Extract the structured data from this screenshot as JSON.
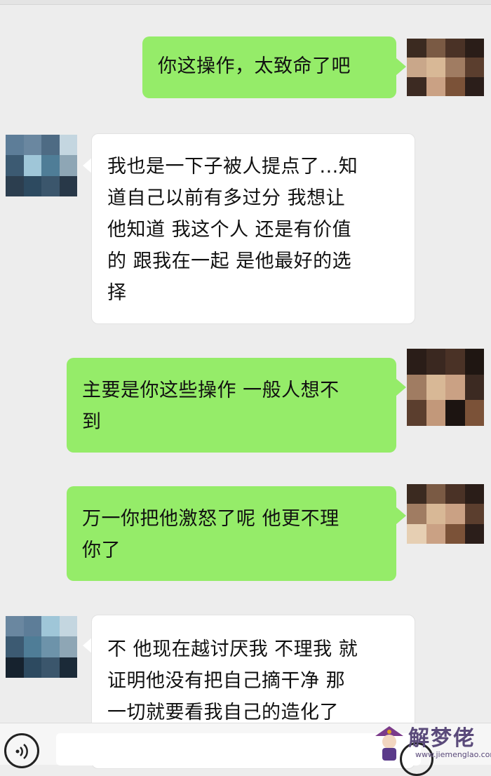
{
  "messages": [
    {
      "side": "me",
      "lines": [
        "你这操作，太致命了吧"
      ]
    },
    {
      "side": "other",
      "lines": [
        "我也是一下子被人提点了...知",
        "道自己以前有多过分 我想让",
        "他知道 我这个人 还是有价值",
        "的 跟我在一起 是他最好的选",
        "择"
      ]
    },
    {
      "side": "me",
      "lines": [
        "主要是你这些操作 一般人想不",
        "到"
      ]
    },
    {
      "side": "me",
      "lines": [
        "万一你把他激怒了呢 他更不理",
        "你了"
      ]
    },
    {
      "side": "other",
      "lines": [
        "不 他现在越讨厌我 不理我 就",
        "证明他没有把自己摘干净 那",
        "一切就要看我自己的造化了"
      ]
    }
  ],
  "input_bar": {
    "voice_icon": "voice-icon",
    "emoji_icon": "emoji-icon",
    "text_value": ""
  },
  "watermark": {
    "title": "解梦佬",
    "url": "www.jiemenglao.com",
    "logo_icon": "fortune-teller-logo"
  },
  "colors": {
    "my_bubble": "#95ec69",
    "other_bubble": "#ffffff",
    "background": "#ededed"
  }
}
